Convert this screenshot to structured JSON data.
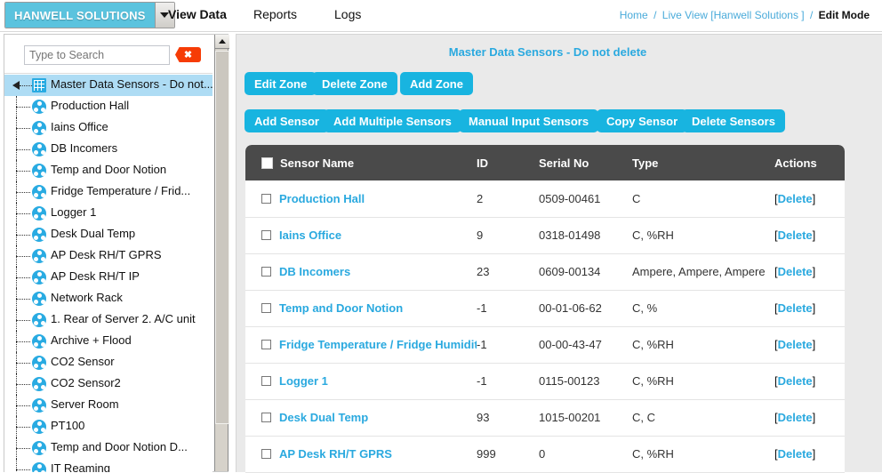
{
  "topnav": {
    "logo": "HANWELL SOLUTIONS",
    "logo_caret_icon": "chevron-down-icon",
    "tabs": [
      {
        "label": "View Data",
        "active": true
      },
      {
        "label": "Reports",
        "active": false
      },
      {
        "label": "Logs",
        "active": false
      }
    ],
    "breadcrumb": {
      "home": "Home",
      "sep": "/",
      "live_view": "Live View [Hanwell Solutions ]",
      "current": "Edit Mode"
    }
  },
  "sidebar": {
    "search": {
      "placeholder": "Type to Search",
      "value": "",
      "clear_label": "✖",
      "clear_icon": "close-icon"
    },
    "root": {
      "label": "Master Data Sensors - Do not...",
      "icon": "grid-icon"
    },
    "items": [
      {
        "label": "Production Hall",
        "icon": "sensor-icon"
      },
      {
        "label": "Iains Office",
        "icon": "sensor-icon"
      },
      {
        "label": "DB Incomers",
        "icon": "sensor-icon"
      },
      {
        "label": "Temp and Door Notion",
        "icon": "sensor-icon"
      },
      {
        "label": "Fridge Temperature / Frid...",
        "icon": "sensor-icon"
      },
      {
        "label": "Logger 1",
        "icon": "sensor-icon"
      },
      {
        "label": "Desk Dual Temp",
        "icon": "sensor-icon"
      },
      {
        "label": "AP Desk RH/T GPRS",
        "icon": "sensor-icon"
      },
      {
        "label": "AP Desk RH/T IP",
        "icon": "sensor-icon"
      },
      {
        "label": "Network Rack",
        "icon": "sensor-icon"
      },
      {
        "label": "1. Rear of Server 2. A/C unit",
        "icon": "sensor-icon"
      },
      {
        "label": "Archive + Flood",
        "icon": "sensor-icon"
      },
      {
        "label": "CO2 Sensor",
        "icon": "sensor-icon"
      },
      {
        "label": "CO2 Sensor2",
        "icon": "sensor-icon"
      },
      {
        "label": "Server Room",
        "icon": "sensor-icon"
      },
      {
        "label": "PT100",
        "icon": "sensor-icon"
      },
      {
        "label": "Temp and Door Notion D...",
        "icon": "sensor-icon"
      },
      {
        "label": "IT Reaming",
        "icon": "sensor-icon"
      }
    ],
    "scrollbar": {
      "up_icon": "scroll-up-icon"
    }
  },
  "main": {
    "zone_title": "Master Data Sensors - Do not delete",
    "zone_buttons": [
      {
        "label": "Edit Zone"
      },
      {
        "label": "Delete Zone"
      },
      {
        "label": "Add Zone"
      }
    ],
    "sensor_buttons": [
      {
        "label": "Add Sensor"
      },
      {
        "label": "Add Multiple Sensors"
      },
      {
        "label": "Manual Input Sensors"
      },
      {
        "label": "Copy Sensor"
      },
      {
        "label": "Delete Sensors"
      }
    ],
    "table": {
      "columns": [
        "Sensor Name",
        "ID",
        "Serial No",
        "Type",
        "Actions"
      ],
      "action_label": "Delete",
      "bracket_open": "[",
      "bracket_close": "]",
      "rows": [
        {
          "name": "Production Hall",
          "id": "2",
          "serial": "0509-00461",
          "type": "C"
        },
        {
          "name": "Iains Office",
          "id": "9",
          "serial": "0318-01498",
          "type": "C, %RH"
        },
        {
          "name": "DB Incomers",
          "id": "23",
          "serial": "0609-00134",
          "type": "Ampere, Ampere, Ampere"
        },
        {
          "name": "Temp and Door Notion",
          "id": "-1",
          "serial": "00-01-06-62",
          "type": "C, %"
        },
        {
          "name": "Fridge Temperature / Fridge Humidity",
          "id": "-1",
          "serial": "00-00-43-47",
          "type": "C, %RH"
        },
        {
          "name": "Logger 1",
          "id": "-1",
          "serial": "0115-00123",
          "type": "C, %RH"
        },
        {
          "name": "Desk Dual Temp",
          "id": "93",
          "serial": "1015-00201",
          "type": "C, C"
        },
        {
          "name": "AP Desk RH/T GPRS",
          "id": "999",
          "serial": "0",
          "type": "C, %RH"
        }
      ]
    }
  },
  "colors": {
    "brand_cyan": "#18b4e0",
    "logo_blue": "#5bc3de",
    "link_blue": "#2aa9df",
    "table_header": "#4a4a4a",
    "page_bg": "#eaeaea",
    "tree_selected": "#aedcf4",
    "clear_orange": "#f63c06"
  }
}
